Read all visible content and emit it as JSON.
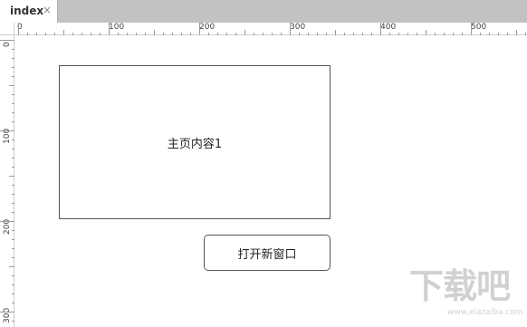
{
  "tabs": [
    {
      "label": "index",
      "close_icon": "×"
    }
  ],
  "ruler": {
    "horizontal_labels": [
      "0",
      "100",
      "200",
      "300",
      "400",
      "500"
    ],
    "vertical_labels": [
      "0",
      "100",
      "200",
      "300"
    ]
  },
  "canvas": {
    "content_box_text": "主页内容1",
    "open_button_label": "打开新窗口"
  },
  "watermark": {
    "text": "下载吧",
    "url": "www.xiazaiba.com"
  },
  "colors": {
    "tabbar_bg": "#c2c2c2",
    "border": "#555555",
    "text": "#222222"
  }
}
